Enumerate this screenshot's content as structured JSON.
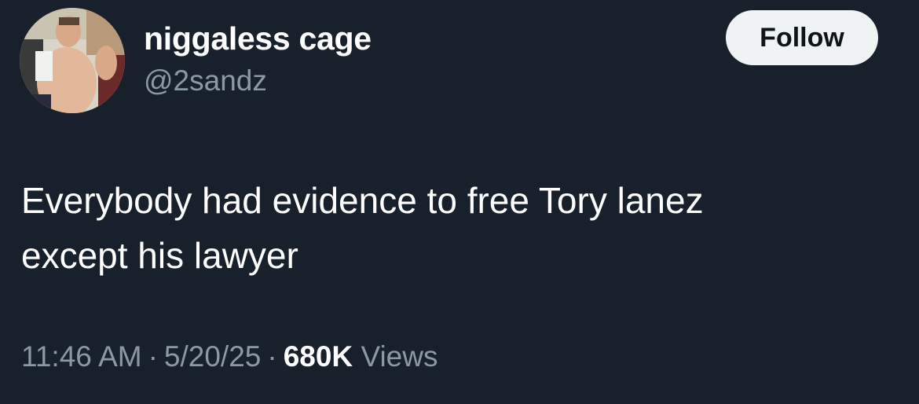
{
  "author": {
    "display_name": "niggaless cage",
    "handle": "@2sandz"
  },
  "follow_button": {
    "label": "Follow"
  },
  "tweet": {
    "line1": "Everybody had evidence to free Tory lanez",
    "line2": "except his lawyer"
  },
  "meta": {
    "time": "11:46 AM",
    "separator": "·",
    "date": "5/20/25",
    "views_count": "680K",
    "views_label": "Views"
  },
  "colors": {
    "background": "#18202b",
    "primary_text": "#ffffff",
    "secondary_text": "#8b98a5",
    "follow_button_bg": "#eff3f4",
    "follow_button_text": "#0f1419"
  }
}
